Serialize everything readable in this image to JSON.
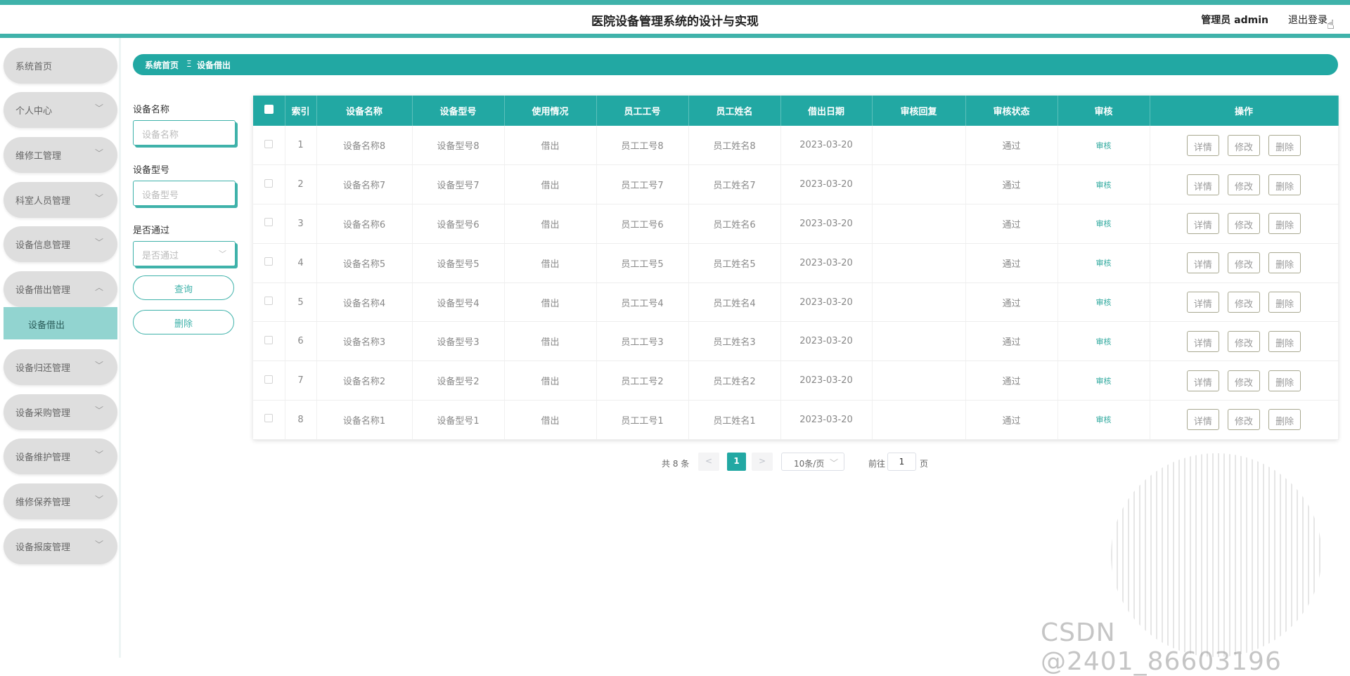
{
  "header": {
    "title": "医院设备管理系统的设计与实现",
    "user_label": "管理员 admin",
    "logout_label": "退出登录"
  },
  "sidebar": {
    "items": [
      {
        "label": "系统首页"
      },
      {
        "label": "个人中心"
      },
      {
        "label": "维修工管理"
      },
      {
        "label": "科室人员管理"
      },
      {
        "label": "设备信息管理"
      },
      {
        "label": "设备借出管理"
      },
      {
        "label": "设备归还管理"
      },
      {
        "label": "设备采购管理"
      },
      {
        "label": "设备维护管理"
      },
      {
        "label": "维修保养管理"
      },
      {
        "label": "设备报废管理"
      }
    ],
    "active_sub_item": "设备借出"
  },
  "breadcrumb": {
    "home": "系统首页",
    "separator": "Ξ",
    "current": "设备借出"
  },
  "filters": {
    "name_label": "设备名称",
    "name_placeholder": "设备名称",
    "model_label": "设备型号",
    "model_placeholder": "设备型号",
    "approved_label": "是否通过",
    "approved_placeholder": "是否通过",
    "query_button": "查询",
    "delete_button": "删除"
  },
  "table": {
    "headers": [
      "索引",
      "设备名称",
      "设备型号",
      "使用情况",
      "员工工号",
      "员工姓名",
      "借出日期",
      "审核回复",
      "审核状态",
      "审核",
      "操作"
    ],
    "rows": [
      {
        "index": "1",
        "name": "设备名称8",
        "model": "设备型号8",
        "usage": "借出",
        "emp_no": "员工工号8",
        "emp_name": "员工姓名8",
        "date": "2023-03-20",
        "reply": "",
        "status": "通过",
        "audit": "审核"
      },
      {
        "index": "2",
        "name": "设备名称7",
        "model": "设备型号7",
        "usage": "借出",
        "emp_no": "员工工号7",
        "emp_name": "员工姓名7",
        "date": "2023-03-20",
        "reply": "",
        "status": "通过",
        "audit": "审核"
      },
      {
        "index": "3",
        "name": "设备名称6",
        "model": "设备型号6",
        "usage": "借出",
        "emp_no": "员工工号6",
        "emp_name": "员工姓名6",
        "date": "2023-03-20",
        "reply": "",
        "status": "通过",
        "audit": "审核"
      },
      {
        "index": "4",
        "name": "设备名称5",
        "model": "设备型号5",
        "usage": "借出",
        "emp_no": "员工工号5",
        "emp_name": "员工姓名5",
        "date": "2023-03-20",
        "reply": "",
        "status": "通过",
        "audit": "审核"
      },
      {
        "index": "5",
        "name": "设备名称4",
        "model": "设备型号4",
        "usage": "借出",
        "emp_no": "员工工号4",
        "emp_name": "员工姓名4",
        "date": "2023-03-20",
        "reply": "",
        "status": "通过",
        "audit": "审核"
      },
      {
        "index": "6",
        "name": "设备名称3",
        "model": "设备型号3",
        "usage": "借出",
        "emp_no": "员工工号3",
        "emp_name": "员工姓名3",
        "date": "2023-03-20",
        "reply": "",
        "status": "通过",
        "audit": "审核"
      },
      {
        "index": "7",
        "name": "设备名称2",
        "model": "设备型号2",
        "usage": "借出",
        "emp_no": "员工工号2",
        "emp_name": "员工姓名2",
        "date": "2023-03-20",
        "reply": "",
        "status": "通过",
        "audit": "审核"
      },
      {
        "index": "8",
        "name": "设备名称1",
        "model": "设备型号1",
        "usage": "借出",
        "emp_no": "员工工号1",
        "emp_name": "员工姓名1",
        "date": "2023-03-20",
        "reply": "",
        "status": "通过",
        "audit": "审核"
      }
    ],
    "row_actions": {
      "detail": "详情",
      "edit": "修改",
      "delete": "删除"
    }
  },
  "pagination": {
    "total_text": "共 8 条",
    "prev": "<",
    "current_page": "1",
    "next": ">",
    "page_size": "10条/页",
    "goto_label": "前往",
    "goto_value": "1",
    "page_word": "页"
  },
  "watermark": "CSDN @2401_86603196",
  "colors": {
    "accent": "#22a8a3",
    "accent_light": "#92d4d0",
    "menu_bg": "#dedede"
  }
}
